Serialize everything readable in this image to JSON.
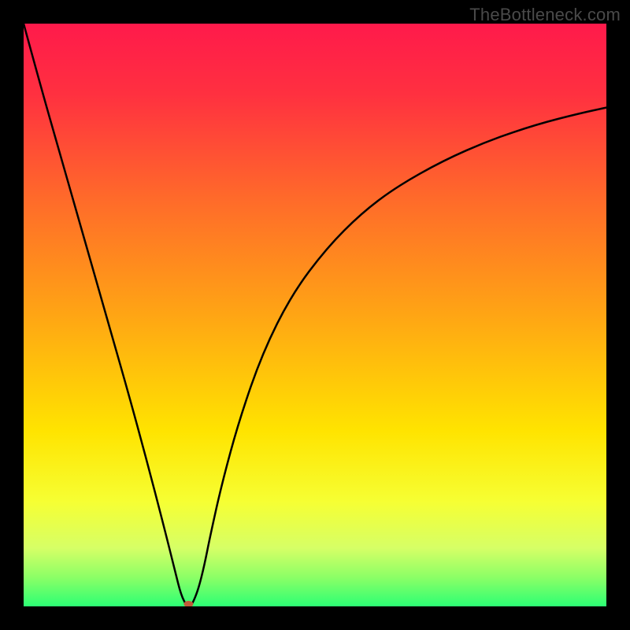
{
  "watermark": "TheBottleneck.com",
  "chart_data": {
    "type": "line",
    "title": "",
    "xlabel": "",
    "ylabel": "",
    "xlim": [
      0,
      100
    ],
    "ylim": [
      0,
      100
    ],
    "grid": false,
    "legend": false,
    "background_gradient": {
      "stops": [
        {
          "offset": 0.0,
          "color": "#ff1a4b"
        },
        {
          "offset": 0.12,
          "color": "#ff3040"
        },
        {
          "offset": 0.3,
          "color": "#ff6a2a"
        },
        {
          "offset": 0.5,
          "color": "#ffa514"
        },
        {
          "offset": 0.7,
          "color": "#ffe400"
        },
        {
          "offset": 0.82,
          "color": "#f6ff33"
        },
        {
          "offset": 0.9,
          "color": "#d6ff66"
        },
        {
          "offset": 0.95,
          "color": "#8cff66"
        },
        {
          "offset": 1.0,
          "color": "#2cff74"
        }
      ]
    },
    "series": [
      {
        "name": "curve",
        "x": [
          0.0,
          3.0,
          6.0,
          9.0,
          12.0,
          15.0,
          18.0,
          21.0,
          24.0,
          26.0,
          27.0,
          28.0,
          28.5,
          29.0,
          30.0,
          31.0,
          32.0,
          34.0,
          37.0,
          41.0,
          46.0,
          52.0,
          58.0,
          64.0,
          72.0,
          80.0,
          88.0,
          95.0,
          100.0
        ],
        "y": [
          100.0,
          89.0,
          78.5,
          68.0,
          57.5,
          47.0,
          36.5,
          25.5,
          14.0,
          6.0,
          2.0,
          0.0,
          0.0,
          0.5,
          3.0,
          7.0,
          12.0,
          21.0,
          32.0,
          43.5,
          53.5,
          61.5,
          67.5,
          72.0,
          76.5,
          80.0,
          82.7,
          84.5,
          85.6
        ]
      }
    ],
    "marker": {
      "x": 28.3,
      "y": 0.4,
      "color": "#c05a3a",
      "rx": 6,
      "ry": 4
    }
  }
}
